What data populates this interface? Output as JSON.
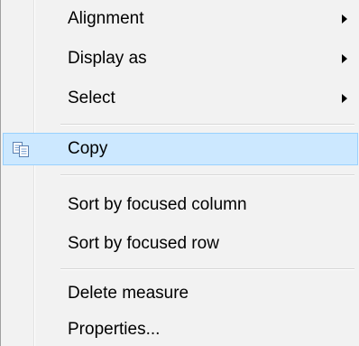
{
  "menu": {
    "items": [
      {
        "label": "Alignment",
        "submenu": true
      },
      {
        "label": "Display as",
        "submenu": true
      },
      {
        "label": "Select",
        "submenu": true
      },
      {
        "label": "Copy",
        "icon": "copy-icon",
        "highlighted": true
      },
      {
        "label": "Sort by focused column"
      },
      {
        "label": "Sort by focused row"
      },
      {
        "label": "Delete measure"
      },
      {
        "label": "Properties..."
      }
    ],
    "colors": {
      "background": "#f2f2f2",
      "highlight": "#cce8ff",
      "highlight_border": "#99d1ff"
    }
  }
}
